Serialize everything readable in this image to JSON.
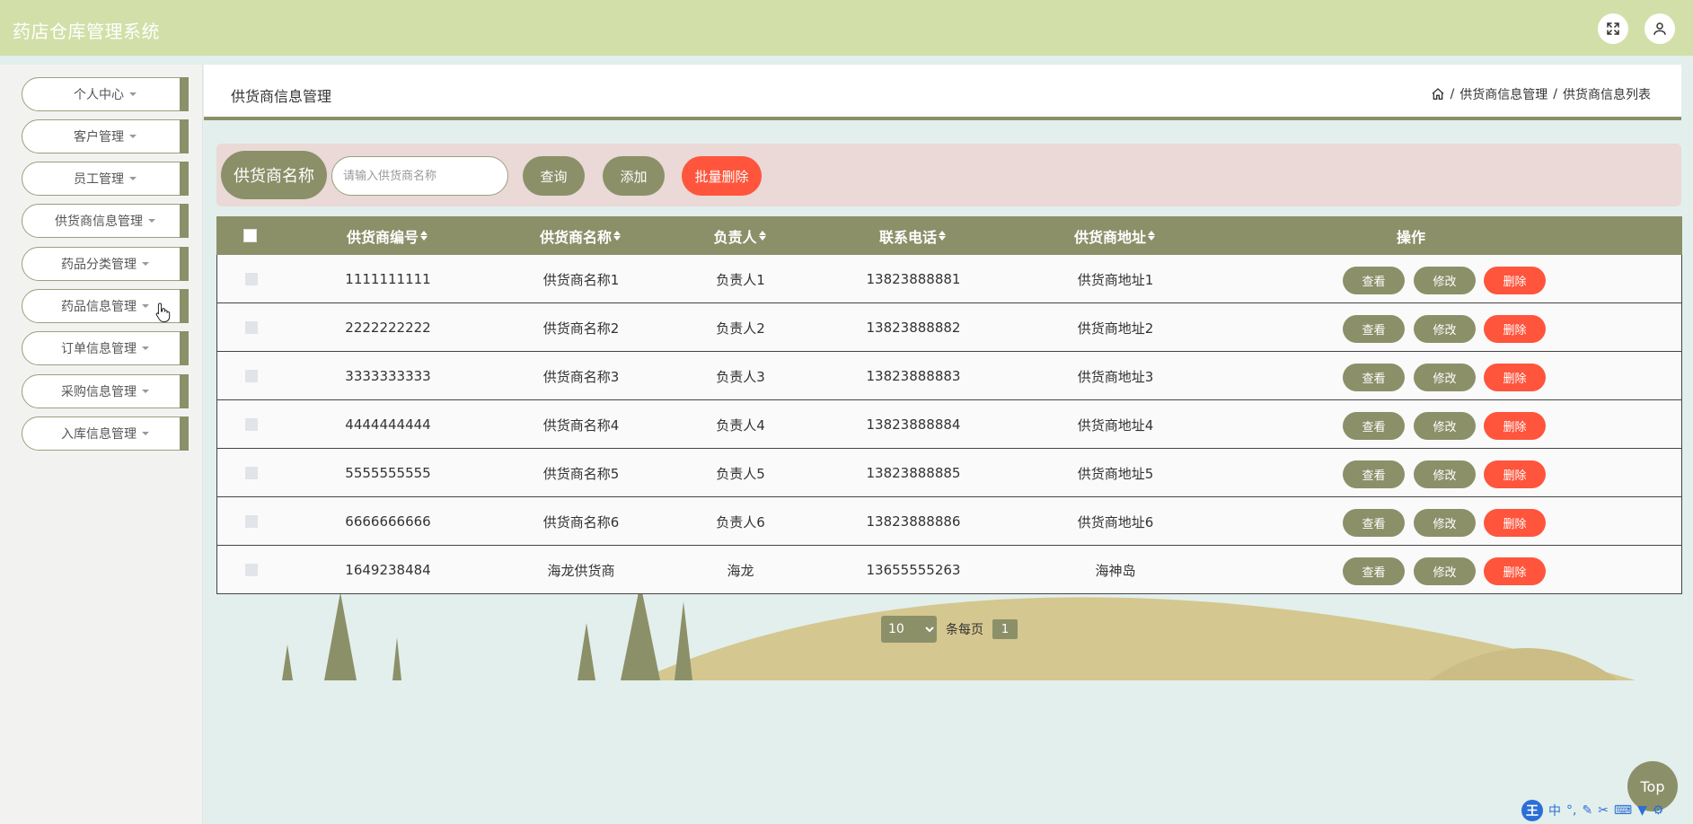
{
  "header": {
    "title": "药店仓库管理系统",
    "icons": [
      "fullscreen-icon",
      "user-icon"
    ]
  },
  "sidebar": {
    "items": [
      {
        "label": "个人中心"
      },
      {
        "label": "客户管理"
      },
      {
        "label": "员工管理"
      },
      {
        "label": "供货商信息管理"
      },
      {
        "label": "药品分类管理"
      },
      {
        "label": "药品信息管理"
      },
      {
        "label": "订单信息管理"
      },
      {
        "label": "采购信息管理"
      },
      {
        "label": "入库信息管理"
      }
    ]
  },
  "page": {
    "title": "供货商信息管理",
    "breadcrumb": [
      "供货商信息管理",
      "供货商信息列表"
    ]
  },
  "search": {
    "label": "供货商名称",
    "placeholder": "请输入供货商名称",
    "query_label": "查询",
    "add_label": "添加",
    "batch_delete_label": "批量删除"
  },
  "table": {
    "columns": [
      "供货商编号",
      "供货商名称",
      "负责人",
      "联系电话",
      "供货商地址",
      "操作"
    ],
    "rows": [
      {
        "id": "1111111111",
        "name": "供货商名称1",
        "person": "负责人1",
        "phone": "13823888881",
        "address": "供货商地址1"
      },
      {
        "id": "2222222222",
        "name": "供货商名称2",
        "person": "负责人2",
        "phone": "13823888882",
        "address": "供货商地址2"
      },
      {
        "id": "3333333333",
        "name": "供货商名称3",
        "person": "负责人3",
        "phone": "13823888883",
        "address": "供货商地址3"
      },
      {
        "id": "4444444444",
        "name": "供货商名称4",
        "person": "负责人4",
        "phone": "13823888884",
        "address": "供货商地址4"
      },
      {
        "id": "5555555555",
        "name": "供货商名称5",
        "person": "负责人5",
        "phone": "13823888885",
        "address": "供货商地址5"
      },
      {
        "id": "6666666666",
        "name": "供货商名称6",
        "person": "负责人6",
        "phone": "13823888886",
        "address": "供货商地址6"
      },
      {
        "id": "1649238484",
        "name": "海龙供货商",
        "person": "海龙",
        "phone": "13655555263",
        "address": "海神岛"
      }
    ],
    "actions": {
      "view": "查看",
      "edit": "修改",
      "delete": "删除"
    }
  },
  "pager": {
    "page_size": "10",
    "page_size_label": "条每页",
    "current_page": "1"
  },
  "back_to_top": "Top",
  "ime": {
    "logo": "王",
    "mode": "中"
  },
  "colors": {
    "accent": "#8b9069",
    "header_bg": "#d3dfa8",
    "danger": "#fe553c",
    "search_bg": "#ead9d6",
    "page_bg": "#e3efec"
  }
}
